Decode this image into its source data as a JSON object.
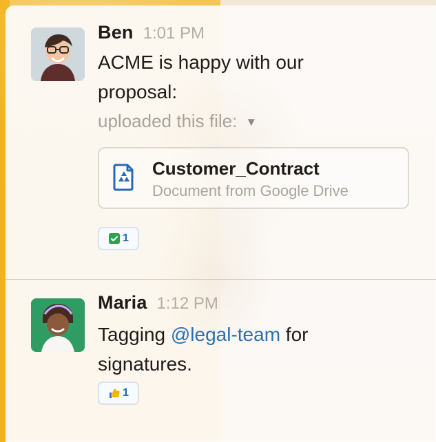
{
  "conversation": {
    "messages": [
      {
        "author": "Ben",
        "time": "1:01 PM",
        "text": "ACME is happy with our proposal:",
        "upload_label": "uploaded this file:",
        "file": {
          "title": "Customer_Contract",
          "subtitle": "Document from Google Drive",
          "icon": "google-drive-icon"
        },
        "reaction": {
          "emoji": "white-check-mark",
          "count": "1"
        }
      },
      {
        "author": "Maria",
        "time": "1:12 PM",
        "text_prefix": "Tagging ",
        "mention": "@legal-team",
        "text_suffix": " for signatures.",
        "reaction": {
          "emoji": "thumbs-up",
          "count": "1"
        }
      }
    ]
  },
  "colors": {
    "accent": "#f2b21b",
    "link": "#2a6fb1",
    "reaction_blue": "#2068b0",
    "checkmark_green": "#2ba24c",
    "thumb_yellow": "#f4b400"
  }
}
